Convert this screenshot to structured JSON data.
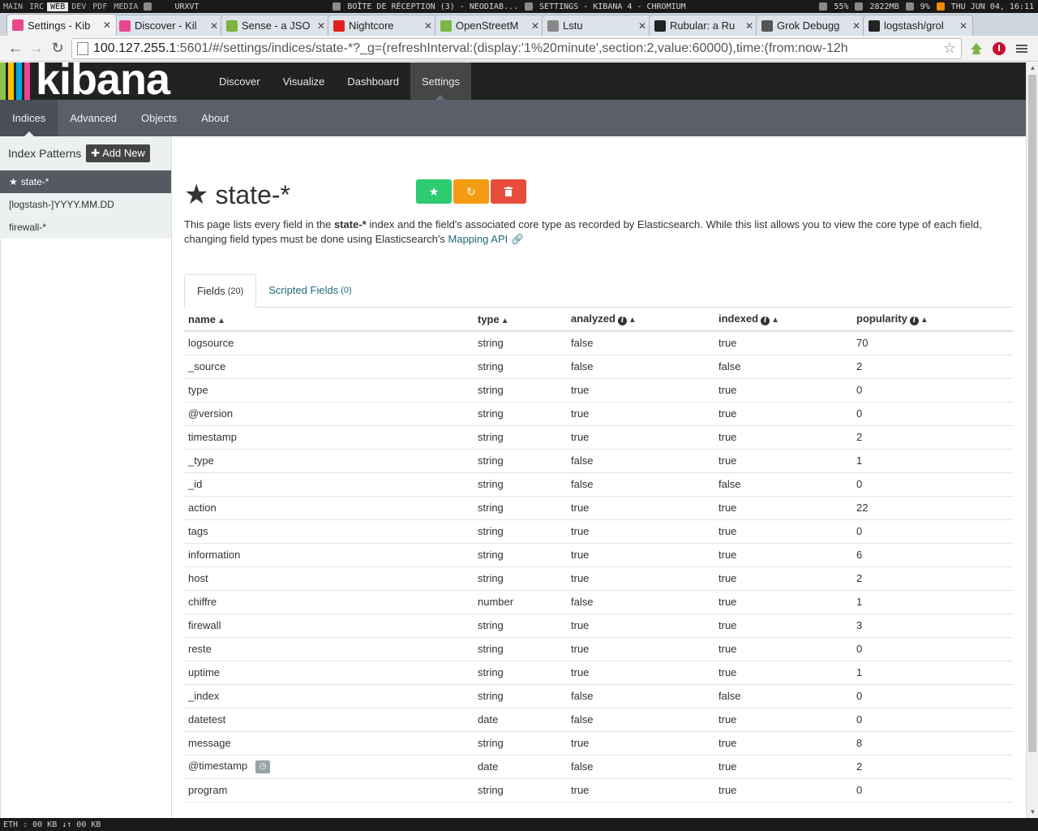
{
  "sysbar": {
    "workspaces": [
      "MAIN",
      "IRC",
      "WEB",
      "DEV",
      "PDF",
      "MEDIA"
    ],
    "active_workspace": "WEB",
    "terminal": "URXVT",
    "mail": "BOÎTE DE RÉCEPTION (3) - NEODIAB...",
    "window_title": "SETTINGS - KIBANA 4 - CHROMIUM",
    "volume": "55%",
    "memory": "2822MB",
    "cpu": "9%",
    "clock": "THU JUN 04, 16:11"
  },
  "browser_tabs": [
    {
      "title": "Settings - Kib",
      "color": "#e8478b"
    },
    {
      "title": "Discover - Kil",
      "color": "#e8478b"
    },
    {
      "title": "Sense - a JSO",
      "color": "#7cb342"
    },
    {
      "title": "Nightcore",
      "color": "#e02020"
    },
    {
      "title": "OpenStreetM",
      "color": "#7ab648"
    },
    {
      "title": "Lstu",
      "color": "#888888"
    },
    {
      "title": "Rubular: a Ru",
      "color": "#222222"
    },
    {
      "title": "Grok Debugg",
      "color": "#555555"
    },
    {
      "title": "logstash/grol",
      "color": "#222222"
    }
  ],
  "omnibox": {
    "url_host": "100.127.255.1",
    "url_rest": ":5601/#/settings/indices/state-*?_g=(refreshInterval:(display:'1%20minute',section:2,value:60000),time:(from:now-12h"
  },
  "kibana": {
    "logo": "kibana",
    "nav": [
      "Discover",
      "Visualize",
      "Dashboard",
      "Settings"
    ],
    "subnav": [
      "Indices",
      "Advanced",
      "Objects",
      "About"
    ]
  },
  "sidebar": {
    "heading": "Index Patterns",
    "add_new": "Add New",
    "patterns": [
      "state-*",
      "[logstash-]YYYY.MM.DD",
      "firewall-*"
    ]
  },
  "main": {
    "title": "state-*",
    "desc_before": "This page lists every field in the ",
    "desc_bold": "state-*",
    "desc_after": " index and the field's associated core type as recorded by Elasticsearch. While this list allows you to view the core type of each field, changing field types must be done using Elasticsearch's ",
    "desc_link": "Mapping API",
    "tabs": [
      {
        "label": "Fields",
        "count": "(20)"
      },
      {
        "label": "Scripted Fields",
        "count": "(0)"
      }
    ],
    "columns": [
      "name",
      "type",
      "analyzed",
      "indexed",
      "popularity"
    ],
    "rows": [
      {
        "name": "logsource",
        "type": "string",
        "analyzed": "false",
        "indexed": "true",
        "popularity": "70"
      },
      {
        "name": "_source",
        "type": "string",
        "analyzed": "false",
        "indexed": "false",
        "popularity": "2"
      },
      {
        "name": "type",
        "type": "string",
        "analyzed": "true",
        "indexed": "true",
        "popularity": "0"
      },
      {
        "name": "@version",
        "type": "string",
        "analyzed": "true",
        "indexed": "true",
        "popularity": "0"
      },
      {
        "name": "timestamp",
        "type": "string",
        "analyzed": "true",
        "indexed": "true",
        "popularity": "2"
      },
      {
        "name": "_type",
        "type": "string",
        "analyzed": "false",
        "indexed": "true",
        "popularity": "1"
      },
      {
        "name": "_id",
        "type": "string",
        "analyzed": "false",
        "indexed": "false",
        "popularity": "0"
      },
      {
        "name": "action",
        "type": "string",
        "analyzed": "true",
        "indexed": "true",
        "popularity": "22"
      },
      {
        "name": "tags",
        "type": "string",
        "analyzed": "true",
        "indexed": "true",
        "popularity": "0"
      },
      {
        "name": "information",
        "type": "string",
        "analyzed": "true",
        "indexed": "true",
        "popularity": "6"
      },
      {
        "name": "host",
        "type": "string",
        "analyzed": "true",
        "indexed": "true",
        "popularity": "2"
      },
      {
        "name": "chiffre",
        "type": "number",
        "analyzed": "false",
        "indexed": "true",
        "popularity": "1"
      },
      {
        "name": "firewall",
        "type": "string",
        "analyzed": "true",
        "indexed": "true",
        "popularity": "3"
      },
      {
        "name": "reste",
        "type": "string",
        "analyzed": "true",
        "indexed": "true",
        "popularity": "0"
      },
      {
        "name": "uptime",
        "type": "string",
        "analyzed": "true",
        "indexed": "true",
        "popularity": "1"
      },
      {
        "name": "_index",
        "type": "string",
        "analyzed": "false",
        "indexed": "false",
        "popularity": "0"
      },
      {
        "name": "datetest",
        "type": "date",
        "analyzed": "false",
        "indexed": "true",
        "popularity": "0"
      },
      {
        "name": "message",
        "type": "string",
        "analyzed": "true",
        "indexed": "true",
        "popularity": "8"
      },
      {
        "name": "@timestamp",
        "type": "date",
        "analyzed": "false",
        "indexed": "true",
        "popularity": "2",
        "time_field": true
      },
      {
        "name": "program",
        "type": "string",
        "analyzed": "true",
        "indexed": "true",
        "popularity": "0"
      }
    ]
  },
  "botbar": "ETH : 00 KB ↓↑ 00 KB",
  "colors": {
    "favorite_btn": "#2ecc71",
    "refresh_btn": "#f39c12",
    "delete_btn": "#e74c3c",
    "link": "#1f6b7a"
  }
}
